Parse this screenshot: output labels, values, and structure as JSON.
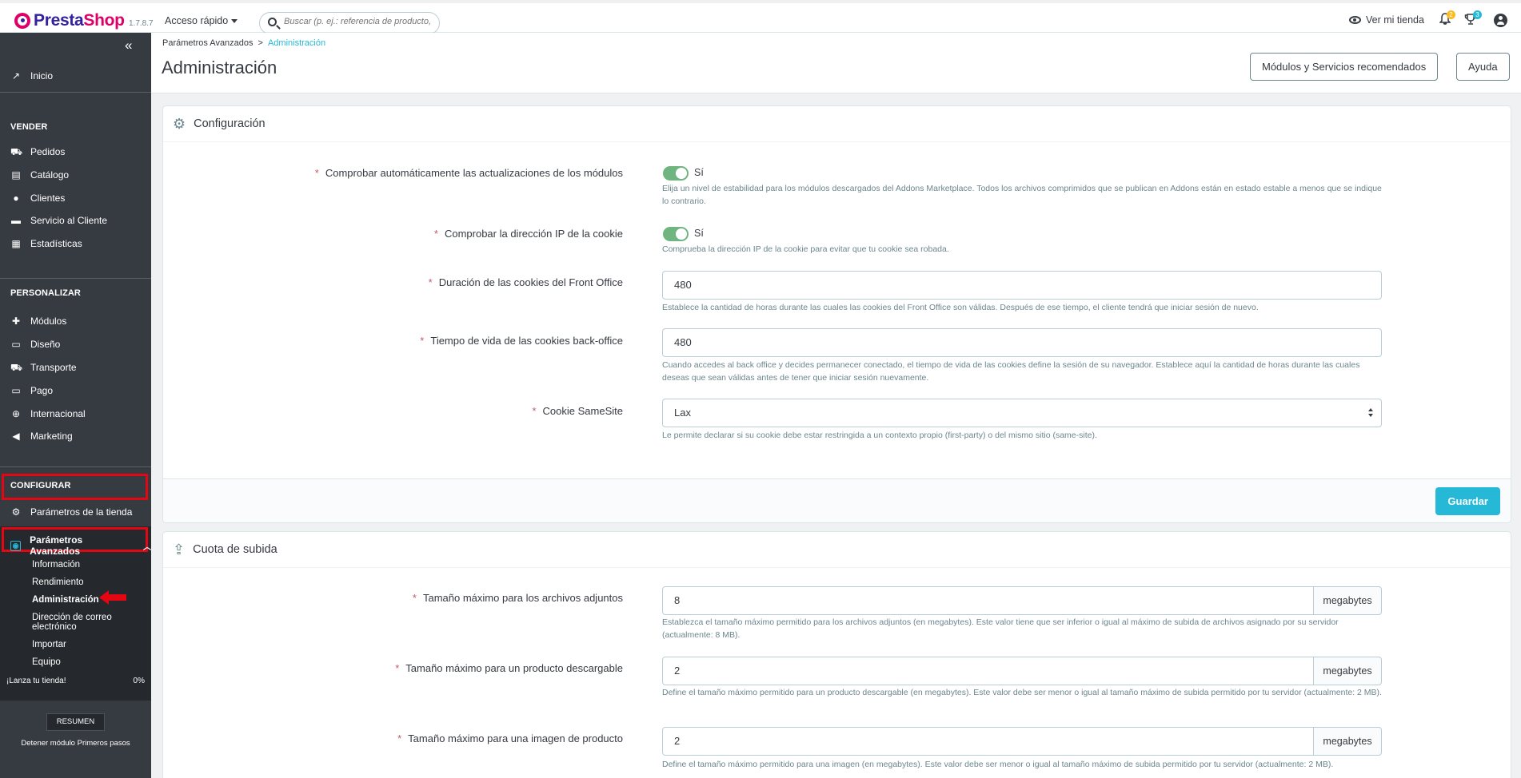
{
  "header": {
    "logo_text": "PrestaShop",
    "version": "1.7.8.7",
    "quick_access": "Acceso rápido",
    "search_placeholder": "Buscar (p. ej.: referencia de producto,",
    "view_store": "Ver mi tienda",
    "notifications_badge": "2",
    "trophy_badge": "3",
    "icons": {
      "notifications": "bell-icon",
      "trophy": "trophy-icon",
      "user": "user-icon"
    }
  },
  "sidebar": {
    "home": "Inicio",
    "sections": {
      "sell": "VENDER",
      "customize": "PERSONALIZAR",
      "configure": "CONFIGURAR"
    },
    "sell_items": [
      "Pedidos",
      "Catálogo",
      "Clientes",
      "Servicio al Cliente",
      "Estadísticas"
    ],
    "customize_items": [
      "Módulos",
      "Diseño",
      "Transporte",
      "Pago",
      "Internacional",
      "Marketing"
    ],
    "configure_items": [
      "Parámetros de la tienda",
      "Parámetros Avanzados"
    ],
    "advanced_sub": [
      "Información",
      "Rendimiento",
      "Administración",
      "Dirección de correo electrónico",
      "Importar",
      "Equipo"
    ],
    "launch_text": "¡Lanza tu tienda!",
    "launch_pct": "0%",
    "launch_progress": 0,
    "resumen": "RESUMEN",
    "stop_module": "Detener módulo Primeros pasos"
  },
  "page": {
    "breadcrumb_parent": "Parámetros Avanzados",
    "breadcrumb_sep": ">",
    "breadcrumb_current": "Administración",
    "title": "Administración",
    "btn_modules": "Módulos y Servicios recomendados",
    "btn_help": "Ayuda"
  },
  "config_panel": {
    "title": "Configuración",
    "rows": {
      "check_modules": {
        "label": "Comprobar automáticamente las actualizaciones de los módulos",
        "toggle_label": "Sí",
        "help": "Elija un nivel de estabilidad para los módulos descargados del Addons Marketplace. Todos los archivos comprimidos que se publican en Addons están en estado estable a menos que se indique lo contrario."
      },
      "check_ip": {
        "label": "Comprobar la dirección IP de la cookie",
        "toggle_label": "Sí",
        "help": "Comprueba la dirección IP de la cookie para evitar que tu cookie sea robada."
      },
      "front_lifetime": {
        "label": "Duración de las cookies del Front Office",
        "value": "480",
        "help": "Establece la cantidad de horas durante las cuales las cookies del Front Office son válidas. Después de ese tiempo, el cliente tendrá que iniciar sesión de nuevo."
      },
      "back_lifetime": {
        "label": "Tiempo de vida de las cookies back-office",
        "value": "480",
        "help": "Cuando accedes al back office y decides permanecer conectado, el tiempo de vida de las cookies define la sesión de su navegador. Establece aquí la cantidad de horas durante las cuales deseas que sean válidas antes de tener que iniciar sesión nuevamente."
      },
      "samesite": {
        "label": "Cookie SameSite",
        "value": "Lax",
        "help": "Le permite declarar si su cookie debe estar restringida a un contexto propio (first-party) o del mismo sitio (same-site)."
      }
    },
    "save": "Guardar"
  },
  "upload_panel": {
    "title": "Cuota de subida",
    "unit": "megabytes",
    "rows": {
      "attachments": {
        "label": "Tamaño máximo para los archivos adjuntos",
        "value": "8",
        "help": "Establezca el tamaño máximo permitido para los archivos adjuntos (en megabytes). Este valor tiene que ser inferior o igual al máximo de subida de archivos asignado por su servidor (actualmente: 8 MB)."
      },
      "download": {
        "label": "Tamaño máximo para un producto descargable",
        "value": "2",
        "help": "Define el tamaño máximo permitido para un producto descargable (en megabytes). Este valor debe ser menor o igual al tamaño máximo de subida permitido por tu servidor (actualmente: 2 MB)."
      },
      "image": {
        "label": "Tamaño máximo para una imagen de producto",
        "value": "2",
        "help": "Define el tamaño máximo permitido para una imagen (en megabytes). Este valor debe ser menor o igual al tamaño máximo de subida permitido por tu servidor (actualmente: 2 MB)."
      }
    }
  }
}
